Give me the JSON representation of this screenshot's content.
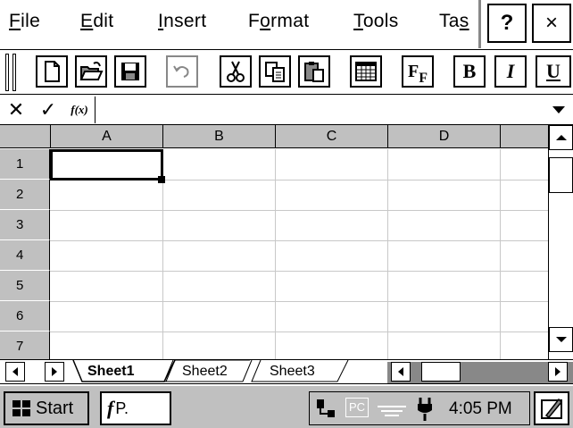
{
  "menu": {
    "items": [
      {
        "label_pre": "",
        "label_u": "F",
        "label_post": "ile"
      },
      {
        "label_pre": "",
        "label_u": "E",
        "label_post": "dit"
      },
      {
        "label_pre": "",
        "label_u": "I",
        "label_post": "nsert"
      },
      {
        "label_pre": "F",
        "label_u": "o",
        "label_post": "rmat"
      },
      {
        "label_pre": "",
        "label_u": "T",
        "label_post": "ools"
      },
      {
        "label_pre": "Ta",
        "label_u": "s",
        "label_post": ""
      }
    ],
    "help_label": "?",
    "close_label": "×"
  },
  "toolbar": {
    "bold_label": "B",
    "italic_label": "I",
    "underline_label": "U",
    "font_label": "F",
    "font_sub": "F"
  },
  "formula_bar": {
    "cancel_label": "✕",
    "accept_label": "✓",
    "function_label": "f(x)",
    "value": ""
  },
  "grid": {
    "columns": [
      "A",
      "B",
      "C",
      "D"
    ],
    "rows": [
      "1",
      "2",
      "3",
      "4",
      "5",
      "6",
      "7"
    ],
    "active_cell": "A1"
  },
  "sheets": {
    "tabs": [
      "Sheet1",
      "Sheet2",
      "Sheet3"
    ],
    "active": "Sheet1"
  },
  "taskbar": {
    "start_label": "Start",
    "app_label": "P.",
    "clock": "4:05 PM",
    "pc_label": "PC"
  }
}
